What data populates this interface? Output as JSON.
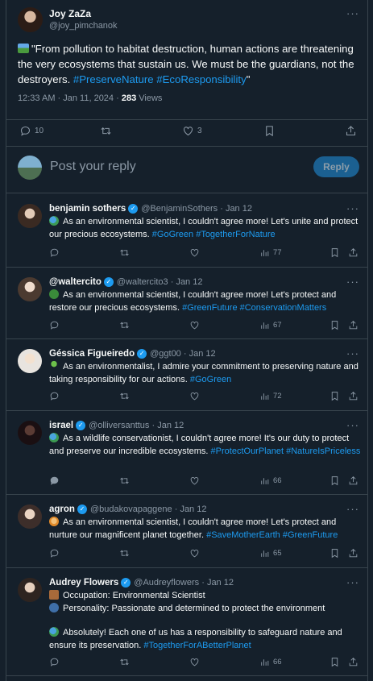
{
  "main": {
    "author_name": "Joy ZaZa",
    "author_handle": "@joy_pimchanok",
    "text": "\"From pollution to habitat destruction, human actions are threatening the very ecosystems that sustain us. We must be the guardians, not the destroyers. ",
    "hashtags": "#PreserveNature #EcoResponsibility",
    "text_end": "\"",
    "time": "12:33 AM · Jan 11, 2024 · ",
    "views_count": "283",
    "views_label": " Views",
    "replies": "10",
    "likes": "3",
    "more": "···"
  },
  "reply_box": {
    "placeholder": "Post your reply",
    "button": "Reply"
  },
  "replies": [
    {
      "name": "benjamin sothers",
      "handle": "@BenjaminSothers",
      "date": "· Jan 12",
      "text": "As an environmental scientist, I couldn't agree more! Let's unite and protect our precious ecosystems. ",
      "tags": "#GoGreen #TogetherForNature",
      "views": "77"
    },
    {
      "name": "@waltercito",
      "handle": "@waltercito3",
      "date": "· Jan 12",
      "text": "As an environmental scientist, I couldn't agree more! Let's protect and restore our precious ecosystems. ",
      "tags": "#GreenFuture #ConservationMatters",
      "views": "67"
    },
    {
      "name": "Géssica Figueiredo",
      "handle": "@ggt00",
      "date": "· Jan 12",
      "text": "As an environmentalist, I admire your commitment to preserving nature and taking responsibility for our actions. ",
      "tags": "#GoGreen",
      "views": "72"
    },
    {
      "name": "israel",
      "handle": "@olliversanttus",
      "date": "· Jan 12",
      "text": "As a wildlife conservationist, I couldn't agree more! It's our duty to protect and preserve our incredible ecosystems. ",
      "tags": "#ProtectOurPlanet #NatureIsPriceless",
      "views": "66"
    },
    {
      "name": "agron",
      "handle": "@budakovapaggene",
      "date": "· Jan 12",
      "text": "As an environmental scientist, I couldn't agree more! Let's protect and nurture our magnificent planet together. ",
      "tags": "#SaveMotherEarth #GreenFuture",
      "views": "65"
    },
    {
      "name": "Audrey Flowers",
      "handle": "@Audreyflowers",
      "date": "· Jan 12",
      "occupation": "Occupation: Environmental Scientist",
      "personality": "Personality: Passionate and determined to protect the environment",
      "text": "Absolutely! Each one of us has a responsibility to safeguard nature and ensure its preservation. ",
      "tags": "#TogetherForABetterPlanet",
      "views": "66"
    }
  ],
  "icons": {
    "reply": "reply-icon",
    "retweet": "retweet-icon",
    "like": "heart-icon",
    "bookmark": "bookmark-icon",
    "share": "share-icon",
    "views": "views-icon",
    "verified": "verified-badge-icon"
  },
  "colors": {
    "background": "#15202b",
    "accent": "#1d9bf0",
    "muted": "#8b98a5",
    "border": "#38444d"
  }
}
